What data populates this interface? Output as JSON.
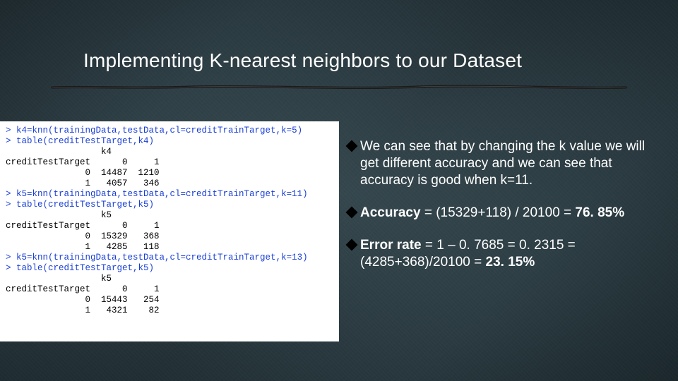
{
  "title": "Implementing K-nearest neighbors to our Dataset",
  "code": {
    "l1": "> k4=knn(trainingData,testData,cl=creditTrainTarget,k=5)",
    "l2": "> table(creditTestTarget,k4)",
    "l3": "                  k4",
    "l4": "creditTestTarget      0     1",
    "l5": "               0  14487  1210",
    "l6": "               1   4057   346",
    "l7": "> k5=knn(trainingData,testData,cl=creditTrainTarget,k=11)",
    "l8": "> table(creditTestTarget,k5)",
    "l9": "                  k5",
    "l10": "creditTestTarget      0     1",
    "l11": "               0  15329   368",
    "l12": "               1   4285   118",
    "l13": "> k5=knn(trainingData,testData,cl=creditTrainTarget,k=13)",
    "l14": "> table(creditTestTarget,k5)",
    "l15": "                  k5",
    "l16": "creditTestTarget      0     1",
    "l17": "               0  15443   254",
    "l18": "               1   4321    82"
  },
  "bullets": {
    "b1_pre": "We can see that by changing the k value we will get different accuracy and we can see that accuracy is good when k=11.",
    "b2_label": "Accuracy",
    "b2_mid": " = (15329+118) / 20100 = ",
    "b2_val": "76. 85%",
    "b3_label": "Error rate",
    "b3_mid": " = 1 – 0. 7685 = 0. 2315 = (4285+368)/20100 = ",
    "b3_val": "23. 15%"
  }
}
